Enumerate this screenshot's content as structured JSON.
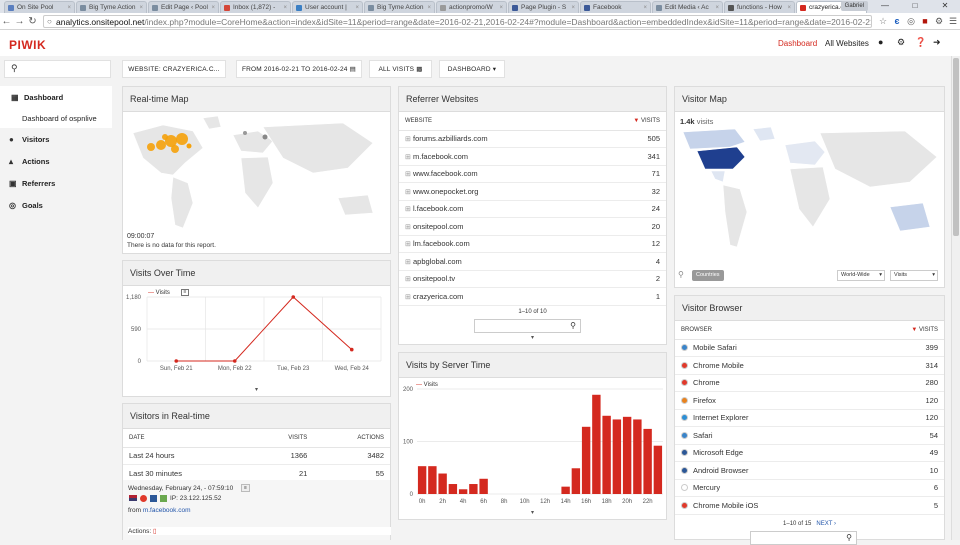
{
  "browser": {
    "tabs": [
      {
        "label": "On Site Pool",
        "color": "#5b7fbf"
      },
      {
        "label": "Big Tyme Action",
        "color": "#7b8da0"
      },
      {
        "label": "Edit Page ‹ Pool",
        "color": "#7b8da0"
      },
      {
        "label": "Inbox (1,872) -",
        "color": "#d44638"
      },
      {
        "label": "User account |",
        "color": "#3b7fc4"
      },
      {
        "label": "Big Tyme Action",
        "color": "#7b8da0"
      },
      {
        "label": "actionpromo/W",
        "color": "#9a9a9a"
      },
      {
        "label": "Page Plugin - S",
        "color": "#3b5998"
      },
      {
        "label": "Facebook",
        "color": "#3b5998"
      },
      {
        "label": "Edit Media ‹ Ac",
        "color": "#7b8da0"
      },
      {
        "label": "functions - How",
        "color": "#555555"
      },
      {
        "label": "crazyerica.com",
        "color": "#d4291f",
        "active": true
      }
    ],
    "profile": "Gabriel",
    "url_domain": "analytics.onsitepool.net",
    "url_path": "/index.php?module=CoreHome&action=index&idSite=11&period=range&date=2016-02-21,2016-02-24#?module=Dashboard&action=embeddedIndex&idSite=11&period=range&date=2016-02-21,2016"
  },
  "header": {
    "logo": "PIWIK",
    "dashboard_link": "Dashboard",
    "all_websites_link": "All Websites"
  },
  "toolbar": {
    "website": "WEBSITE: CRAZYERICA.C...",
    "date_range": "FROM 2016-02-21 TO 2016-02-24",
    "segment": "ALL VISITS",
    "dashboard": "DASHBOARD"
  },
  "sidebar": {
    "items": [
      {
        "label": "Dashboard",
        "icon": "dashboard-icon"
      },
      {
        "label": "Dashboard of ospnlive"
      },
      {
        "label": "Visitors",
        "icon": "visitors-icon"
      },
      {
        "label": "Actions",
        "icon": "actions-icon"
      },
      {
        "label": "Referrers",
        "icon": "referrers-icon"
      },
      {
        "label": "Goals",
        "icon": "goals-icon"
      }
    ]
  },
  "realtime_map": {
    "title": "Real-time Map",
    "time": "09:00:07",
    "message": "There is no data for this report."
  },
  "visits_over_time": {
    "title": "Visits Over Time",
    "legend": "Visits"
  },
  "visitors_realtime": {
    "title": "Visitors in Real-time",
    "col_date": "DATE",
    "col_visits": "VISITS",
    "col_actions": "ACTIONS",
    "rows": [
      {
        "label": "Last 24 hours",
        "visits": "1366",
        "actions": "3482"
      },
      {
        "label": "Last 30 minutes",
        "visits": "21",
        "actions": "55"
      }
    ],
    "visit_time": "Wednesday, February 24, - 07:59:10",
    "ip": "IP: 23.122.125.52",
    "from_label": "from",
    "from_link": "m.facebook.com",
    "actions_label": "Actions:"
  },
  "referrer_websites": {
    "title": "Referrer Websites",
    "col_website": "WEBSITE",
    "col_visits": "VISITS",
    "rows": [
      {
        "site": "forums.azbilliards.com",
        "visits": "505"
      },
      {
        "site": "m.facebook.com",
        "visits": "341"
      },
      {
        "site": "www.facebook.com",
        "visits": "71"
      },
      {
        "site": "www.onepocket.org",
        "visits": "32"
      },
      {
        "site": "l.facebook.com",
        "visits": "24"
      },
      {
        "site": "onsitepool.com",
        "visits": "20"
      },
      {
        "site": "lm.facebook.com",
        "visits": "12"
      },
      {
        "site": "apbglobal.com",
        "visits": "4"
      },
      {
        "site": "onsitepool.tv",
        "visits": "2"
      },
      {
        "site": "crazyerica.com",
        "visits": "1"
      }
    ],
    "pager": "1–10 of 10"
  },
  "server_time": {
    "title": "Visits by Server Time",
    "legend": "Visits"
  },
  "visitor_map": {
    "title": "Visitor Map",
    "summary_value": "1.4k",
    "summary_label": "visits",
    "btn_countries": "Countries",
    "select_region": "World-Wide",
    "select_metric": "Visits"
  },
  "visitor_browser": {
    "title": "Visitor Browser",
    "col_browser": "BROWSER",
    "col_visits": "VISITS",
    "rows": [
      {
        "name": "Mobile Safari",
        "visits": "399",
        "color": "#3a84c9"
      },
      {
        "name": "Chrome Mobile",
        "visits": "314",
        "color": "#e0392b"
      },
      {
        "name": "Chrome",
        "visits": "280",
        "color": "#e0392b"
      },
      {
        "name": "Firefox",
        "visits": "120",
        "color": "#e8821e"
      },
      {
        "name": "Internet Explorer",
        "visits": "120",
        "color": "#2d8fd5"
      },
      {
        "name": "Safari",
        "visits": "54",
        "color": "#3a84c9"
      },
      {
        "name": "Microsoft Edge",
        "visits": "49",
        "color": "#2b5797"
      },
      {
        "name": "Android Browser",
        "visits": "10",
        "color": "#2b5797"
      },
      {
        "name": "Mercury",
        "visits": "6",
        "color": "#ffffff"
      },
      {
        "name": "Chrome Mobile iOS",
        "visits": "5",
        "color": "#e0392b"
      }
    ],
    "pager": "1–10 of 15",
    "next": "NEXT ›"
  },
  "chart_data": [
    {
      "type": "line",
      "title": "Visits Over Time",
      "categories": [
        "Sun, Feb 21",
        "Mon, Feb 22",
        "Tue, Feb 23",
        "Wed, Feb 24"
      ],
      "series": [
        {
          "name": "Visits",
          "values": [
            0,
            0,
            1180,
            210
          ]
        }
      ],
      "ylim": [
        0,
        1180
      ],
      "yticks": [
        "0",
        "590",
        "1,180"
      ],
      "color": "#d4291f"
    },
    {
      "type": "bar",
      "title": "Visits by Server Time",
      "categories": [
        "0h",
        "1h",
        "2h",
        "3h",
        "4h",
        "5h",
        "6h",
        "7h",
        "8h",
        "9h",
        "10h",
        "11h",
        "12h",
        "13h",
        "14h",
        "15h",
        "16h",
        "17h",
        "18h",
        "19h",
        "20h",
        "21h",
        "22h",
        "23h"
      ],
      "tick_labels": [
        "0h",
        "2h",
        "4h",
        "6h",
        "8h",
        "10h",
        "12h",
        "14h",
        "16h",
        "18h",
        "20h",
        "22h"
      ],
      "series": [
        {
          "name": "Visits",
          "values": [
            53,
            53,
            39,
            19,
            9,
            19,
            29,
            0,
            0,
            0,
            0,
            0,
            0,
            0,
            14,
            49,
            128,
            189,
            149,
            142,
            147,
            142,
            124,
            92
          ]
        }
      ],
      "ylim": [
        0,
        200
      ],
      "yticks": [
        "0",
        "100",
        "200"
      ],
      "color": "#d4291f"
    }
  ]
}
